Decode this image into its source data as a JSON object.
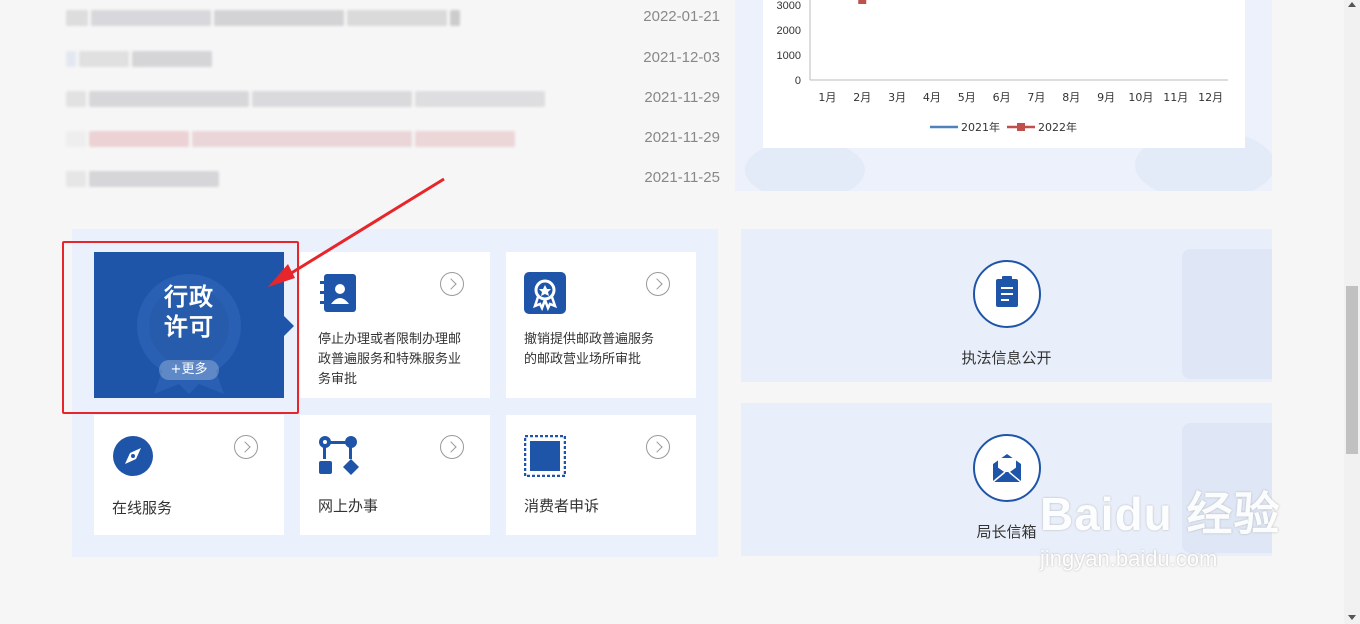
{
  "news": {
    "dates": [
      "2022-01-21",
      "2021-12-03",
      "2021-11-29",
      "2021-11-29",
      "2021-11-25"
    ]
  },
  "chart_data": {
    "type": "line",
    "categories": [
      "1月",
      "2月",
      "3月",
      "4月",
      "5月",
      "6月",
      "7月",
      "8月",
      "9月",
      "10月",
      "11月",
      "12月"
    ],
    "y_ticks": [
      "3000",
      "2000",
      "1000",
      "0"
    ],
    "series": [
      {
        "name": "2021年",
        "color": "#4f81bd",
        "values": []
      },
      {
        "name": "2022年",
        "color": "#c0504d",
        "values": [
          null,
          3200
        ]
      }
    ]
  },
  "services": {
    "feature_title": "行政许可",
    "feature_more": "+更多",
    "tiles": [
      {
        "icon": "contact-book-icon",
        "label": "停止办理或者限制办理邮政普遍服务和特殊服务业务审批"
      },
      {
        "icon": "award-badge-icon",
        "label": "撤销提供邮政普遍服务的邮政营业场所审批"
      },
      {
        "icon": "compass-icon",
        "label": "在线服务"
      },
      {
        "icon": "workflow-icon",
        "label": "网上办事"
      },
      {
        "icon": "stamp-icon",
        "label": "消费者申诉"
      }
    ]
  },
  "side_cards": [
    {
      "icon": "clipboard-icon",
      "label": "执法信息公开"
    },
    {
      "icon": "mail-icon",
      "label": "局长信箱"
    }
  ],
  "watermark": {
    "brand": "Baidu 经验",
    "url": "jingyan.baidu.com"
  },
  "colors": {
    "brand": "#1f55a8",
    "panel": "#eaf1fd",
    "highlight": "#e6262b"
  }
}
